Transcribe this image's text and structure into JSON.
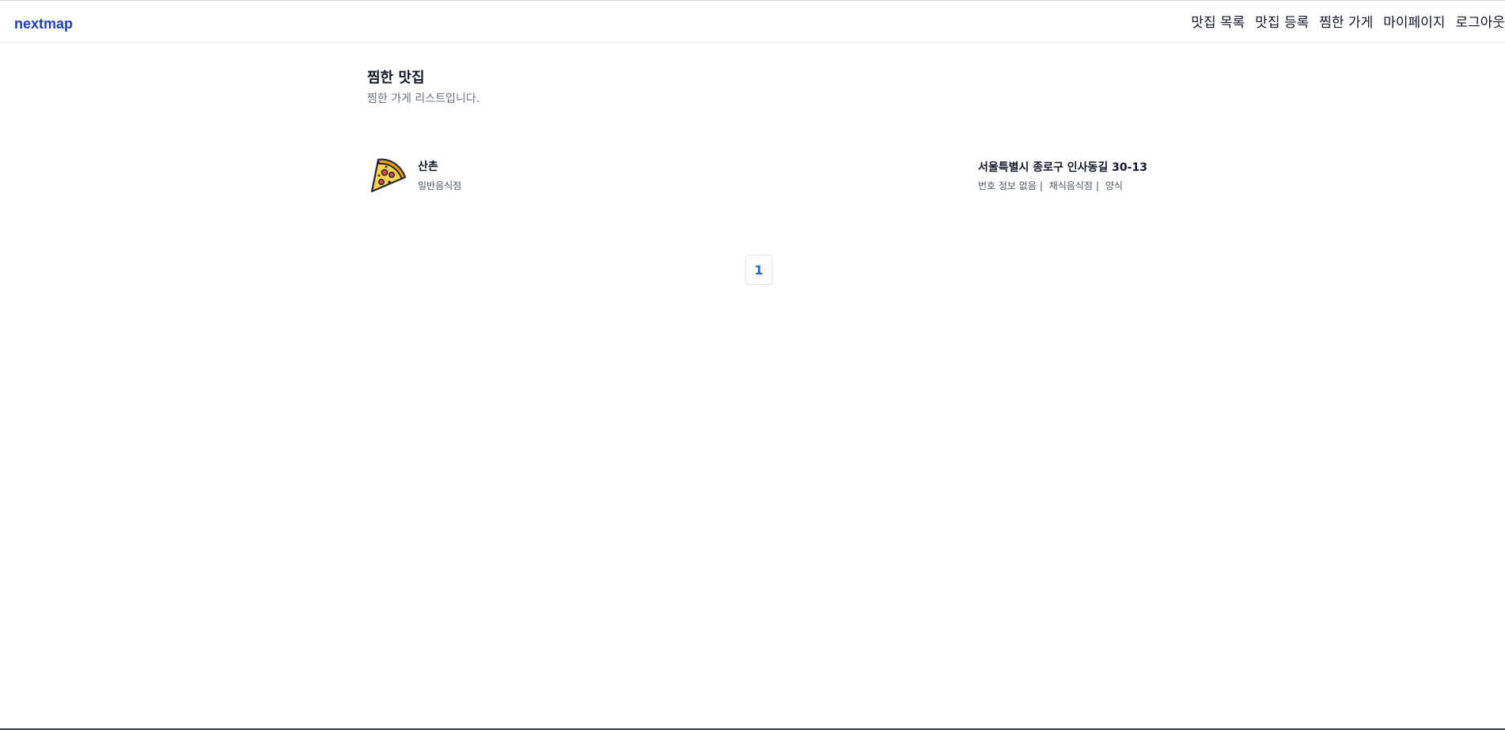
{
  "navbar": {
    "logo": "nextmap",
    "items": [
      {
        "label": "맛집 목록"
      },
      {
        "label": "맛집 등록"
      },
      {
        "label": "찜한 가게"
      },
      {
        "label": "마이페이지"
      },
      {
        "label": "로그아웃"
      }
    ]
  },
  "page": {
    "title": "찜한 맛집",
    "subtitle": "찜한 가게 리스트입니다."
  },
  "stores": [
    {
      "name": "산촌",
      "category": "일반음식점",
      "address": "서울특별시 종로구 인사동길 30-13",
      "phone": "번호 정보 없음",
      "food_type": "채식음식점",
      "cuisine": "양식",
      "icon": "pizza-icon"
    }
  ],
  "pagination": {
    "pages": [
      "1"
    ],
    "current": "1"
  },
  "colors": {
    "brand": "#1e40af",
    "page_accent": "#2563eb"
  }
}
